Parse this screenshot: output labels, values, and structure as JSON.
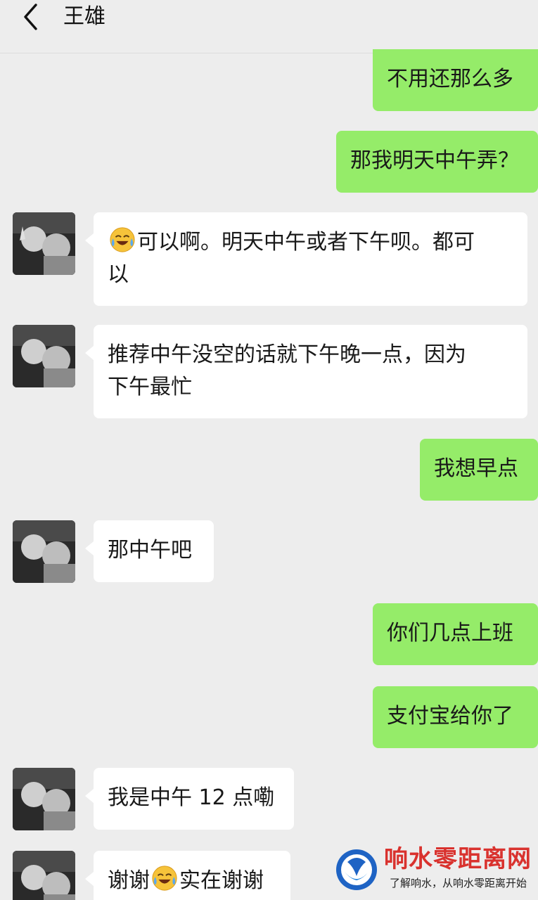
{
  "header": {
    "title": "王雄",
    "back_icon": "chevron-left-icon"
  },
  "colors": {
    "background": "#ededed",
    "outgoing_bubble": "#95ec69",
    "incoming_bubble": "#ffffff",
    "watermark_red": "#d9322e"
  },
  "messages": [
    {
      "side": "out",
      "text": "不用还那么多"
    },
    {
      "side": "out",
      "text": "那我明天中午弄？"
    },
    {
      "side": "in",
      "emoji": "crying-laughing-emoji",
      "text_line1": "可以啊。明天中午或者下午呗。都可",
      "text_line2": "以"
    },
    {
      "side": "in",
      "text_line1": "推荐中午没空的话就下午晚一点，因为",
      "text_line2": "下午最忙"
    },
    {
      "side": "out",
      "text": "我想早点"
    },
    {
      "side": "in",
      "text": "那中午吧"
    },
    {
      "side": "out",
      "text": "你们几点上班"
    },
    {
      "side": "out",
      "text": "支付宝给你了"
    },
    {
      "side": "in",
      "text": "我是中午 12 点嘞"
    },
    {
      "side": "in",
      "text_before": "谢谢",
      "emoji": "crying-laughing-emoji",
      "text_after": "实在谢谢"
    }
  ],
  "watermark": {
    "title": "响水零距离网",
    "subtitle": "了解响水，从响水零距离开始"
  }
}
